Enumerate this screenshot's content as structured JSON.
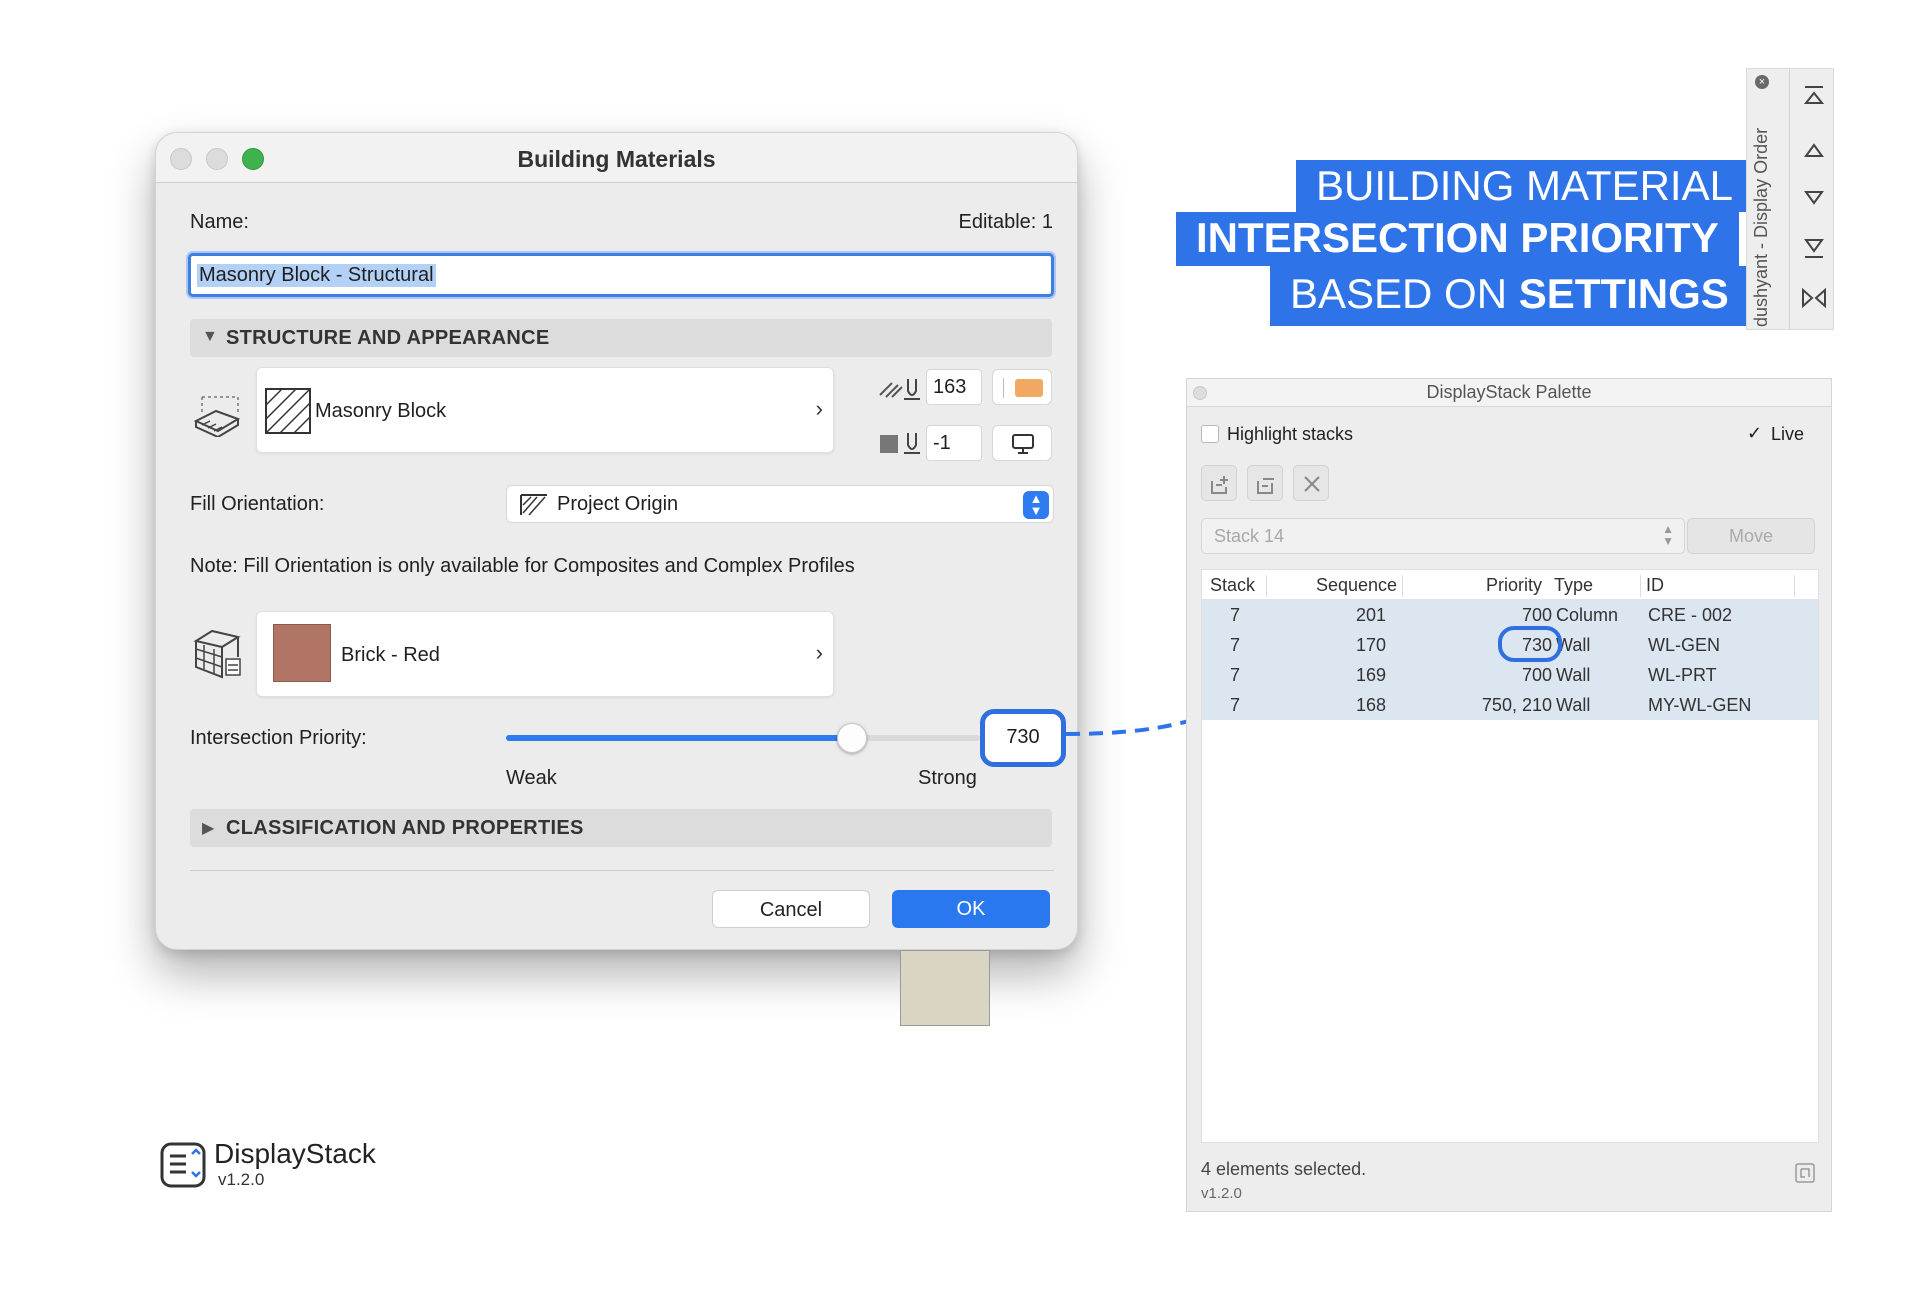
{
  "dialog": {
    "title": "Building Materials",
    "name_label": "Name:",
    "editable": "Editable: 1",
    "name_value": "Masonry Block - Structural",
    "section_structure": "STRUCTURE AND APPEARANCE",
    "cut_fill": "Masonry Block",
    "pen_fill": "163",
    "pen_bg": "-1",
    "fill_orientation_label": "Fill Orientation:",
    "fill_orientation_value": "Project Origin",
    "note": "Note: Fill Orientation is only available for Composites and Complex Profiles",
    "surface": "Brick - Red",
    "intersection_label": "Intersection Priority:",
    "intersection_value": "730",
    "intersection_level": 0.73,
    "weak": "Weak",
    "strong": "Strong",
    "section_classification": "CLASSIFICATION AND PROPERTIES",
    "cancel": "Cancel",
    "ok": "OK"
  },
  "banner": {
    "line1": "BUILDING MATERIAL",
    "line2": "INTERSECTION PRIORITY",
    "line3_a": "BASED ON",
    "line3_b": "SETTINGS"
  },
  "order_bar": {
    "label": "dushyant - Display Order"
  },
  "palette": {
    "title": "DisplayStack Palette",
    "highlight": "Highlight stacks",
    "live": "Live",
    "live_checked": true,
    "stack_select": "Stack 14",
    "move": "Move",
    "columns": [
      "Stack",
      "Sequence",
      "Priority",
      "Type",
      "ID"
    ],
    "rows": [
      {
        "stack": "7",
        "seq": "201",
        "prio": "700",
        "type": "Column",
        "id": "CRE - 002"
      },
      {
        "stack": "7",
        "seq": "170",
        "prio": "730",
        "type": "Wall",
        "id": "WL-GEN"
      },
      {
        "stack": "7",
        "seq": "169",
        "prio": "700",
        "type": "Wall",
        "id": "WL-PRT"
      },
      {
        "stack": "7",
        "seq": "168",
        "prio": "750, 210",
        "type": "Wall",
        "id": "MY-WL-GEN"
      }
    ],
    "status": "4 elements selected.",
    "version": "v1.2.0"
  },
  "logo": {
    "name": "DisplayStack",
    "version": "v1.2.0"
  },
  "colors": {
    "accent": "#2e74e8",
    "surface_swatch": "#b07565",
    "pen_swatch": "#f0a862",
    "row_highlight": "#dce6f0"
  }
}
